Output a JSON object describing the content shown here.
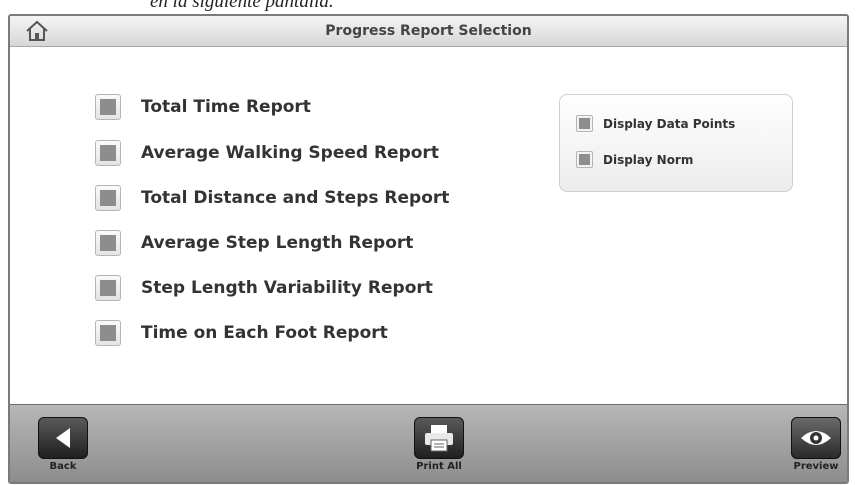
{
  "caption": "en la siguiente pantalla.",
  "titlebar": {
    "title": "Progress Report Selection"
  },
  "reports": [
    {
      "label": "Total Time Report"
    },
    {
      "label": "Average Walking Speed Report"
    },
    {
      "label": "Total Distance and Steps Report"
    },
    {
      "label": "Average Step Length Report"
    },
    {
      "label": "Step Length Variability Report"
    },
    {
      "label": "Time on Each Foot Report"
    }
  ],
  "display_options": [
    {
      "label": "Display Data Points"
    },
    {
      "label": "Display Norm"
    }
  ],
  "footer": {
    "back_label": "Back",
    "print_label": "Print All",
    "preview_label": "Preview"
  },
  "icons": {
    "home": "home-icon",
    "back": "back-arrow-icon",
    "print": "printer-icon",
    "preview": "eye-icon"
  }
}
